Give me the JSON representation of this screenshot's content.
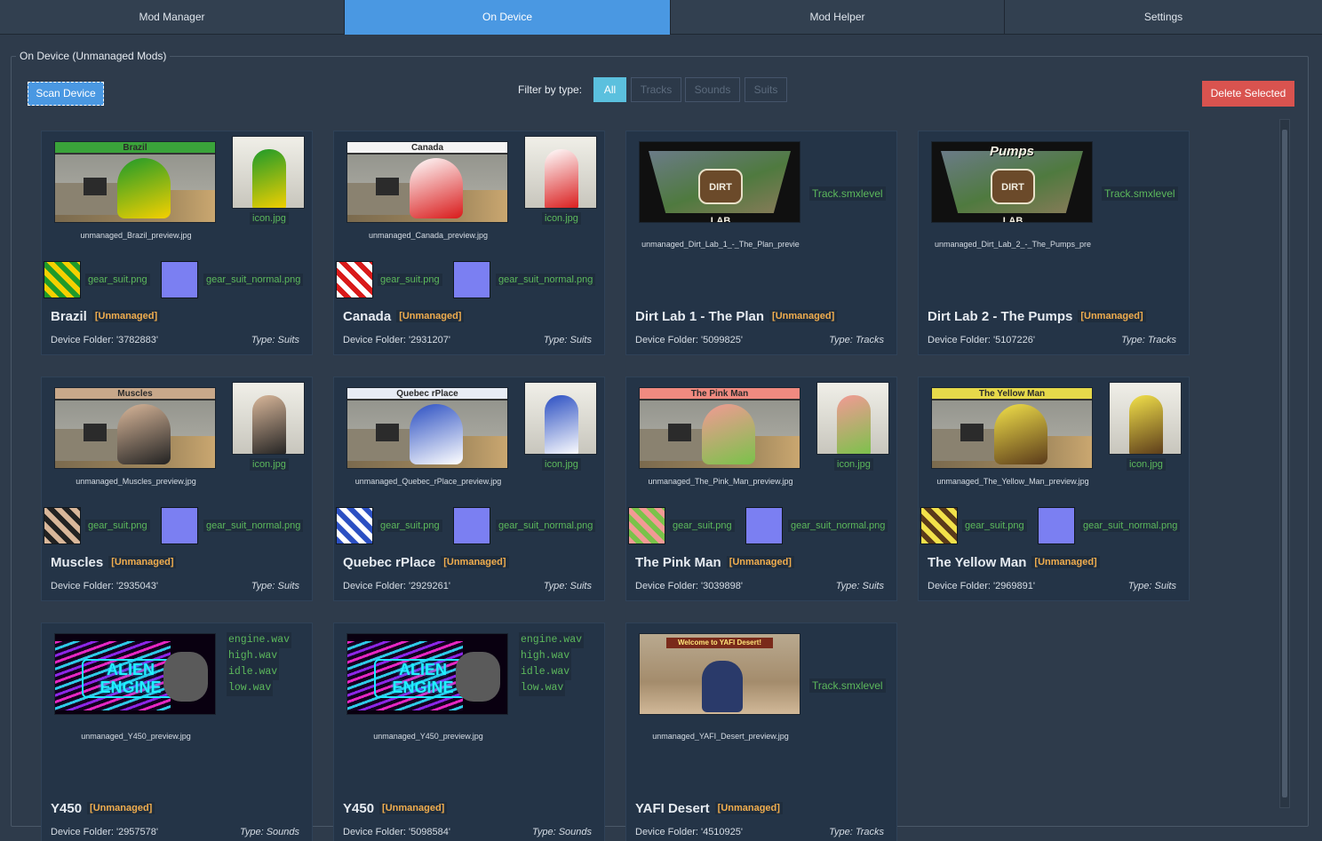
{
  "tabs": [
    {
      "label": "Mod Manager",
      "active": false
    },
    {
      "label": "On Device",
      "active": true
    },
    {
      "label": "Mod Helper",
      "active": false
    },
    {
      "label": "Settings",
      "active": false
    }
  ],
  "group_title": "On Device (Unmanaged Mods)",
  "toolbar": {
    "scan_label": "Scan Device",
    "filter_label": "Filter by type:",
    "filters": [
      "All",
      "Tracks",
      "Sounds",
      "Suits"
    ],
    "active_filter": "All",
    "delete_label": "Delete Selected"
  },
  "cards": [
    {
      "name": "Brazil",
      "badge": "[Unmanaged]",
      "folder": "Device Folder: '3782883'",
      "type": "Type: Suits",
      "preview_caption": "unmanaged_Brazil_preview.jpg",
      "banner": "Brazil",
      "icon_label": "icon.jpg",
      "gear_label": "gear_suit.png",
      "normal_label": "gear_suit_normal.png",
      "colors": {
        "banner": "#3aa33a",
        "suit": "#1e9a2a",
        "suit2": "#f5d000"
      }
    },
    {
      "name": "Canada",
      "badge": "[Unmanaged]",
      "folder": "Device Folder: '2931207'",
      "type": "Type: Suits",
      "preview_caption": "unmanaged_Canada_preview.jpg",
      "banner": "Canada",
      "icon_label": "icon.jpg",
      "gear_label": "gear_suit.png",
      "normal_label": "gear_suit_normal.png",
      "colors": {
        "banner": "#f4f4f4",
        "suit": "#ffffff",
        "suit2": "#d91a1a"
      }
    },
    {
      "name": "Dirt Lab 1 - The Plan",
      "badge": "[Unmanaged]",
      "folder": "Device Folder: '5099825'",
      "type": "Type: Tracks",
      "preview_caption": "unmanaged_Dirt_Lab_1_-_The_Plan_previe",
      "logo": "DIRT LAB",
      "level_label": "Track.smxlevel"
    },
    {
      "name": "Dirt Lab 2 - The Pumps",
      "badge": "[Unmanaged]",
      "folder": "Device Folder: '5107226'",
      "type": "Type: Tracks",
      "preview_caption": "unmanaged_Dirt_Lab_2_-_The_Pumps_pre",
      "logo": "DIRT LAB",
      "logo_title": "Pumps",
      "level_label": "Track.smxlevel"
    },
    {
      "name": "Muscles",
      "badge": "[Unmanaged]",
      "folder": "Device Folder: '2935043'",
      "type": "Type: Suits",
      "preview_caption": "unmanaged_Muscles_preview.jpg",
      "banner": "Muscles",
      "icon_label": "icon.jpg",
      "gear_label": "gear_suit.png",
      "normal_label": "gear_suit_normal.png",
      "colors": {
        "banner": "#c8a88a",
        "suit": "#d9b79a",
        "suit2": "#222222"
      }
    },
    {
      "name": "Quebec rPlace",
      "badge": "[Unmanaged]",
      "folder": "Device Folder: '2929261'",
      "type": "Type: Suits",
      "preview_caption": "unmanaged_Quebec_rPlace_preview.jpg",
      "banner": "Quebec rPlace",
      "icon_label": "icon.jpg",
      "gear_label": "gear_suit.png",
      "normal_label": "gear_suit_normal.png",
      "colors": {
        "banner": "#e8ecf5",
        "suit": "#2b4fc2",
        "suit2": "#ffffff"
      }
    },
    {
      "name": "The Pink Man",
      "badge": "[Unmanaged]",
      "folder": "Device Folder: '3039898'",
      "type": "Type: Suits",
      "preview_caption": "unmanaged_The_Pink_Man_preview.jpg",
      "banner": "The Pink Man",
      "icon_label": "icon.jpg",
      "gear_label": "gear_suit.png",
      "normal_label": "gear_suit_normal.png",
      "colors": {
        "banner": "#f08a80",
        "suit": "#f29a95",
        "suit2": "#7ac24a"
      }
    },
    {
      "name": "The Yellow Man",
      "badge": "[Unmanaged]",
      "folder": "Device Folder: '2969891'",
      "type": "Type: Suits",
      "preview_caption": "unmanaged_The_Yellow_Man_preview.jpg",
      "banner": "The Yellow Man",
      "icon_label": "icon.jpg",
      "gear_label": "gear_suit.png",
      "normal_label": "gear_suit_normal.png",
      "colors": {
        "banner": "#e6d94a",
        "suit": "#f2e14a",
        "suit2": "#5a3a1a"
      }
    },
    {
      "name": "Y450",
      "badge": "[Unmanaged]",
      "folder": "Device Folder: '2957578'",
      "type": "Type: Sounds",
      "preview_caption": "unmanaged_Y450_preview.jpg",
      "logo": "ALIEN ENGINE",
      "sounds": [
        "engine.wav",
        "high.wav",
        "idle.wav",
        "low.wav"
      ]
    },
    {
      "name": "Y450",
      "badge": "[Unmanaged]",
      "folder": "Device Folder: '5098584'",
      "type": "Type: Sounds",
      "preview_caption": "unmanaged_Y450_preview.jpg",
      "logo": "ALIEN ENGINE",
      "sounds": [
        "engine.wav",
        "high.wav",
        "idle.wav",
        "low.wav"
      ]
    },
    {
      "name": "YAFI Desert",
      "badge": "[Unmanaged]",
      "folder": "Device Folder: '4510925'",
      "type": "Type: Tracks",
      "preview_caption": "unmanaged_YAFI_Desert_preview.jpg",
      "banner": "Welcome to YAFI Desert!",
      "level_label": "Track.smxlevel"
    }
  ]
}
